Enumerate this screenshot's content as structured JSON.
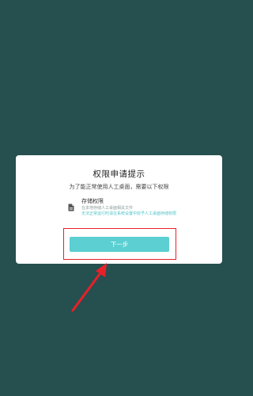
{
  "dialog": {
    "title": "权限申请提示",
    "subtitle": "为了能正常使用人工桌面，需要以下权限",
    "permissions": [
      {
        "icon": "document-icon",
        "name": "存储权限",
        "description": "在本地存储人工桌面相关文件",
        "note": "无法正常运行时请在系统设置中授予人工桌面存储权限"
      }
    ],
    "next_button_label": "下一步"
  },
  "annotation": {
    "highlight_color": "#e8202a"
  },
  "colors": {
    "background": "#264f4f",
    "dialog_bg": "#ffffff",
    "accent": "#5bcfd1",
    "note_text": "#4fc4c7"
  }
}
